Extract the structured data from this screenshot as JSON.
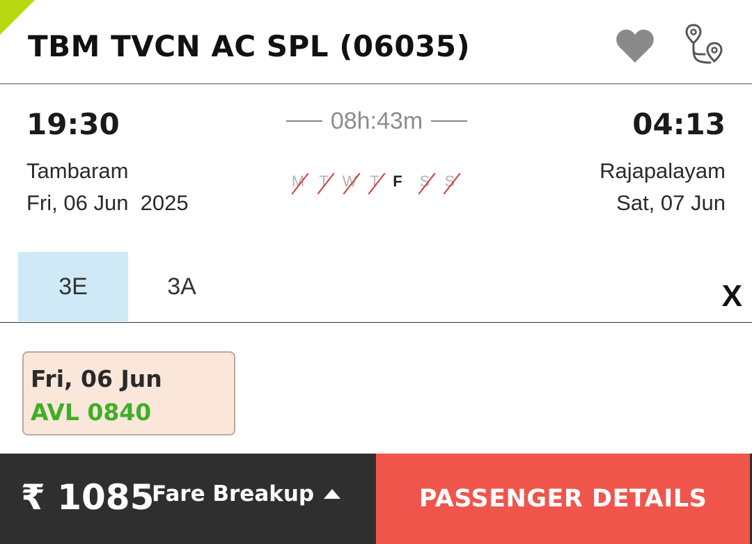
{
  "header": {
    "train_title": "TBM TVCN AC SPL (06035)",
    "favorite_icon": "heart-icon",
    "route_icon": "route-map-icon",
    "accent_color": "#b8d90f"
  },
  "journey": {
    "departure_time": "19:30",
    "arrival_time": "04:13",
    "duration": "08h:43m",
    "departure_station": "Tambaram",
    "departure_date": "Fri, 06 Jun  2025",
    "arrival_station": "Rajapalayam",
    "arrival_date": "Sat, 07 Jun",
    "running_days": [
      {
        "label": "M",
        "runs": false
      },
      {
        "label": "T",
        "runs": false
      },
      {
        "label": "W",
        "runs": false
      },
      {
        "label": "T",
        "runs": false
      },
      {
        "label": "F",
        "runs": true
      },
      {
        "label": "S",
        "runs": false
      },
      {
        "label": "S",
        "runs": false
      }
    ]
  },
  "classes": {
    "tabs": [
      {
        "label": "3E",
        "selected": true
      },
      {
        "label": "3A",
        "selected": false
      }
    ],
    "close_label": "X"
  },
  "availability": {
    "date": "Fri, 06 Jun",
    "status": "AVL 0840",
    "status_color": "#3fae27"
  },
  "footer": {
    "price": "₹ 1085",
    "fare_breakup_label": "Fare Breakup",
    "passenger_button_label": "PASSENGER DETAILS",
    "button_color": "#f0554b"
  }
}
